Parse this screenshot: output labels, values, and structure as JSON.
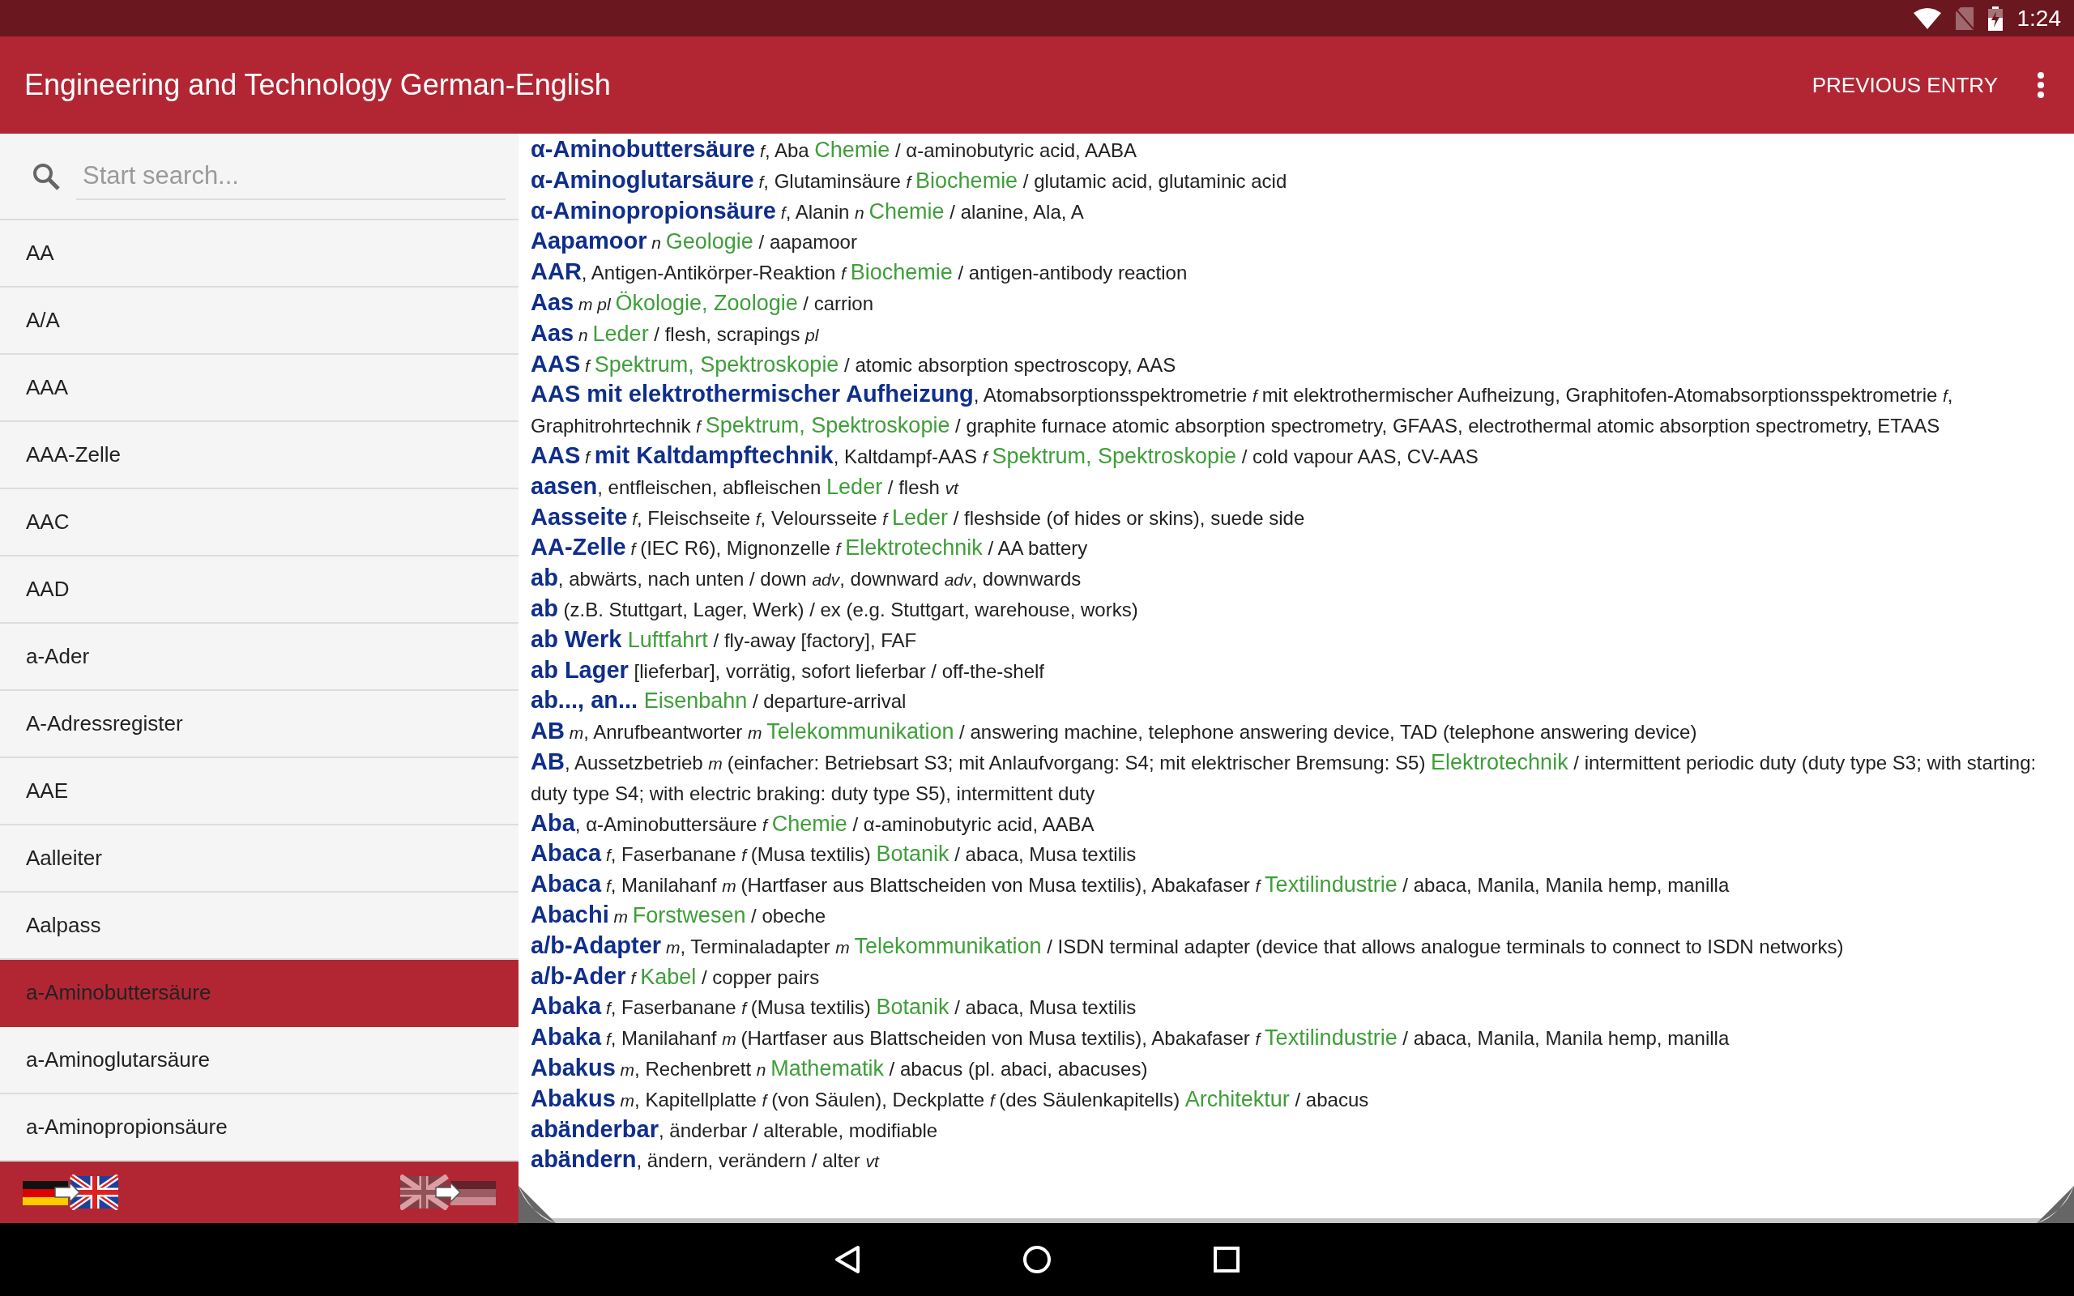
{
  "status_bar": {
    "time": "1:24"
  },
  "app_bar": {
    "title": "Engineering and Technology German-English",
    "actions": [
      "PREVIOUS ENTRY"
    ]
  },
  "search": {
    "placeholder": "Start search..."
  },
  "sidebar": {
    "items": [
      {
        "label": "AA",
        "selected": false
      },
      {
        "label": "A/A",
        "selected": false
      },
      {
        "label": "AAA",
        "selected": false
      },
      {
        "label": "AAA-Zelle",
        "selected": false
      },
      {
        "label": "AAC",
        "selected": false
      },
      {
        "label": "AAD",
        "selected": false
      },
      {
        "label": "a-Ader",
        "selected": false
      },
      {
        "label": "A-Adressregister",
        "selected": false
      },
      {
        "label": "AAE",
        "selected": false
      },
      {
        "label": "Aalleiter",
        "selected": false
      },
      {
        "label": "Aalpass",
        "selected": false
      },
      {
        "label": "a-Aminobuttersäure",
        "selected": true
      },
      {
        "label": "a-Aminoglutarsäure",
        "selected": false
      },
      {
        "label": "a-Aminopropionsäure",
        "selected": false
      }
    ]
  },
  "entries": [
    [
      {
        "kind": "head",
        "text": "α-Aminobuttersäure"
      },
      {
        "kind": "gram",
        "text": " f"
      },
      {
        "kind": "text",
        "text": ", Aba "
      },
      {
        "kind": "field",
        "text": "Chemie"
      },
      {
        "kind": "text",
        "text": " / α-aminobutyric acid, AABA"
      }
    ],
    [
      {
        "kind": "head",
        "text": "α-Aminoglutarsäure"
      },
      {
        "kind": "gram",
        "text": " f"
      },
      {
        "kind": "text",
        "text": ", Glutaminsäure "
      },
      {
        "kind": "gram",
        "text": "f "
      },
      {
        "kind": "field",
        "text": "Biochemie"
      },
      {
        "kind": "text",
        "text": " / glutamic acid, glutaminic acid"
      }
    ],
    [
      {
        "kind": "head",
        "text": "α-Aminopropionsäure"
      },
      {
        "kind": "gram",
        "text": " f"
      },
      {
        "kind": "text",
        "text": ", Alanin "
      },
      {
        "kind": "gram",
        "text": "n "
      },
      {
        "kind": "field",
        "text": "Chemie"
      },
      {
        "kind": "text",
        "text": " / alanine, Ala, A"
      }
    ],
    [
      {
        "kind": "head",
        "text": "Aapamoor"
      },
      {
        "kind": "gram",
        "text": " n "
      },
      {
        "kind": "field",
        "text": "Geologie"
      },
      {
        "kind": "text",
        "text": " / aapamoor"
      }
    ],
    [
      {
        "kind": "head",
        "text": "AAR"
      },
      {
        "kind": "text",
        "text": ", Antigen-Antikörper-Reaktion "
      },
      {
        "kind": "gram",
        "text": "f "
      },
      {
        "kind": "field",
        "text": "Biochemie"
      },
      {
        "kind": "text",
        "text": " / antigen-antibody reaction"
      }
    ],
    [
      {
        "kind": "head",
        "text": "Aas"
      },
      {
        "kind": "gram",
        "text": " m pl "
      },
      {
        "kind": "field",
        "text": "Ökologie, Zoologie"
      },
      {
        "kind": "text",
        "text": " / carrion"
      }
    ],
    [
      {
        "kind": "head",
        "text": "Aas"
      },
      {
        "kind": "gram",
        "text": " n "
      },
      {
        "kind": "field",
        "text": "Leder"
      },
      {
        "kind": "text",
        "text": " / flesh, scrapings "
      },
      {
        "kind": "gram",
        "text": "pl"
      }
    ],
    [
      {
        "kind": "head",
        "text": "AAS"
      },
      {
        "kind": "gram",
        "text": " f "
      },
      {
        "kind": "field",
        "text": "Spektrum, Spektroskopie"
      },
      {
        "kind": "text",
        "text": " / atomic absorption spectroscopy, AAS"
      }
    ],
    [
      {
        "kind": "head",
        "text": "AAS mit elektrothermischer Aufheizung"
      },
      {
        "kind": "text",
        "text": ", Atomabsorptionsspektrometrie "
      },
      {
        "kind": "gram",
        "text": "f "
      },
      {
        "kind": "text",
        "text": "mit elektrothermischer Aufheizung, Graphitofen-Atomabsorptionsspektrometrie "
      },
      {
        "kind": "gram",
        "text": "f"
      },
      {
        "kind": "text",
        "text": ", Graphitrohrtechnik "
      },
      {
        "kind": "gram",
        "text": "f "
      },
      {
        "kind": "field",
        "text": "Spektrum, Spektroskopie"
      },
      {
        "kind": "text",
        "text": " / graphite furnace atomic absorption spectrometry, GFAAS, electrothermal atomic absorption spectrometry, ETAAS"
      }
    ],
    [
      {
        "kind": "head",
        "text": "AAS"
      },
      {
        "kind": "gram",
        "text": " f "
      },
      {
        "kind": "head",
        "text": "mit Kaltdampftechnik"
      },
      {
        "kind": "text",
        "text": ", Kaltdampf-AAS "
      },
      {
        "kind": "gram",
        "text": "f "
      },
      {
        "kind": "field",
        "text": "Spektrum, Spektroskopie"
      },
      {
        "kind": "text",
        "text": " / cold vapour AAS, CV-AAS"
      }
    ],
    [
      {
        "kind": "head",
        "text": "aasen"
      },
      {
        "kind": "text",
        "text": ", entfleischen, abfleischen "
      },
      {
        "kind": "field",
        "text": "Leder"
      },
      {
        "kind": "text",
        "text": " / flesh "
      },
      {
        "kind": "gram",
        "text": "vt"
      }
    ],
    [
      {
        "kind": "head",
        "text": "Aasseite"
      },
      {
        "kind": "gram",
        "text": " f"
      },
      {
        "kind": "text",
        "text": ", Fleischseite "
      },
      {
        "kind": "gram",
        "text": "f"
      },
      {
        "kind": "text",
        "text": ", Veloursseite "
      },
      {
        "kind": "gram",
        "text": "f "
      },
      {
        "kind": "field",
        "text": "Leder"
      },
      {
        "kind": "text",
        "text": " / fleshside (of hides or skins), suede side"
      }
    ],
    [
      {
        "kind": "head",
        "text": "AA-Zelle"
      },
      {
        "kind": "gram",
        "text": " f "
      },
      {
        "kind": "text",
        "text": "(IEC R6), Mignonzelle "
      },
      {
        "kind": "gram",
        "text": "f "
      },
      {
        "kind": "field",
        "text": "Elektrotechnik"
      },
      {
        "kind": "text",
        "text": " / AA battery"
      }
    ],
    [
      {
        "kind": "head",
        "text": "ab"
      },
      {
        "kind": "text",
        "text": ", abwärts, nach unten / down "
      },
      {
        "kind": "gram",
        "text": "adv"
      },
      {
        "kind": "text",
        "text": ", downward "
      },
      {
        "kind": "gram",
        "text": "adv"
      },
      {
        "kind": "text",
        "text": ", downwards"
      }
    ],
    [
      {
        "kind": "head",
        "text": "ab"
      },
      {
        "kind": "text",
        "text": " (z.B. Stuttgart, Lager, Werk) / ex (e.g. Stuttgart, warehouse, works)"
      }
    ],
    [
      {
        "kind": "head",
        "text": "ab Werk"
      },
      {
        "kind": "field",
        "text": " Luftfahrt"
      },
      {
        "kind": "text",
        "text": " / fly-away [factory], FAF"
      }
    ],
    [
      {
        "kind": "head",
        "text": "ab Lager"
      },
      {
        "kind": "text",
        "text": " [lieferbar], vorrätig, sofort lieferbar / off-the-shelf"
      }
    ],
    [
      {
        "kind": "head",
        "text": "ab..., an..."
      },
      {
        "kind": "field",
        "text": " Eisenbahn"
      },
      {
        "kind": "text",
        "text": " / departure-arrival"
      }
    ],
    [
      {
        "kind": "head",
        "text": "AB"
      },
      {
        "kind": "gram",
        "text": " m"
      },
      {
        "kind": "text",
        "text": ", Anrufbeantworter "
      },
      {
        "kind": "gram",
        "text": "m "
      },
      {
        "kind": "field",
        "text": "Telekommunikation"
      },
      {
        "kind": "text",
        "text": " / answering machine, telephone answering device, TAD (telephone answering device)"
      }
    ],
    [
      {
        "kind": "head",
        "text": "AB"
      },
      {
        "kind": "text",
        "text": ", Aussetzbetrieb "
      },
      {
        "kind": "gram",
        "text": "m "
      },
      {
        "kind": "text",
        "text": "(einfacher: Betriebsart S3; mit Anlaufvorgang: S4; mit elektrischer Bremsung: S5) "
      },
      {
        "kind": "field",
        "text": "Elektrotechnik"
      },
      {
        "kind": "text",
        "text": " / intermittent periodic duty (duty type S3; with starting: duty type S4; with electric braking: duty type S5), intermittent duty"
      }
    ],
    [
      {
        "kind": "head",
        "text": "Aba"
      },
      {
        "kind": "text",
        "text": ", α-Aminobuttersäure "
      },
      {
        "kind": "gram",
        "text": "f "
      },
      {
        "kind": "field",
        "text": "Chemie"
      },
      {
        "kind": "text",
        "text": " / α-aminobutyric acid, AABA"
      }
    ],
    [
      {
        "kind": "head",
        "text": "Abaca"
      },
      {
        "kind": "gram",
        "text": " f"
      },
      {
        "kind": "text",
        "text": ", Faserbanane "
      },
      {
        "kind": "gram",
        "text": "f "
      },
      {
        "kind": "text",
        "text": "(Musa textilis) "
      },
      {
        "kind": "field",
        "text": "Botanik"
      },
      {
        "kind": "text",
        "text": " / abaca, Musa textilis"
      }
    ],
    [
      {
        "kind": "head",
        "text": "Abaca"
      },
      {
        "kind": "gram",
        "text": " f"
      },
      {
        "kind": "text",
        "text": ", Manilahanf "
      },
      {
        "kind": "gram",
        "text": "m "
      },
      {
        "kind": "text",
        "text": "(Hartfaser aus Blattscheiden von Musa textilis), Abakafaser "
      },
      {
        "kind": "gram",
        "text": "f "
      },
      {
        "kind": "field",
        "text": "Textilindustrie"
      },
      {
        "kind": "text",
        "text": " / abaca, Manila, Manila hemp, manilla"
      }
    ],
    [
      {
        "kind": "head",
        "text": "Abachi"
      },
      {
        "kind": "gram",
        "text": " m "
      },
      {
        "kind": "field",
        "text": "Forstwesen"
      },
      {
        "kind": "text",
        "text": " / obeche"
      }
    ],
    [
      {
        "kind": "head",
        "text": "a/b-Adapter"
      },
      {
        "kind": "gram",
        "text": " m"
      },
      {
        "kind": "text",
        "text": ", Terminaladapter "
      },
      {
        "kind": "gram",
        "text": "m "
      },
      {
        "kind": "field",
        "text": "Telekommunikation"
      },
      {
        "kind": "text",
        "text": " / ISDN terminal adapter (device that allows analogue terminals to connect to ISDN networks)"
      }
    ],
    [
      {
        "kind": "head",
        "text": "a/b-Ader"
      },
      {
        "kind": "gram",
        "text": " f "
      },
      {
        "kind": "field",
        "text": "Kabel"
      },
      {
        "kind": "text",
        "text": " / copper pairs"
      }
    ],
    [
      {
        "kind": "head",
        "text": "Abaka"
      },
      {
        "kind": "gram",
        "text": " f"
      },
      {
        "kind": "text",
        "text": ", Faserbanane "
      },
      {
        "kind": "gram",
        "text": "f "
      },
      {
        "kind": "text",
        "text": "(Musa textilis) "
      },
      {
        "kind": "field",
        "text": "Botanik"
      },
      {
        "kind": "text",
        "text": " / abaca, Musa textilis"
      }
    ],
    [
      {
        "kind": "head",
        "text": "Abaka"
      },
      {
        "kind": "gram",
        "text": " f"
      },
      {
        "kind": "text",
        "text": ", Manilahanf "
      },
      {
        "kind": "gram",
        "text": "m "
      },
      {
        "kind": "text",
        "text": "(Hartfaser aus Blattscheiden von Musa textilis), Abakafaser "
      },
      {
        "kind": "gram",
        "text": "f "
      },
      {
        "kind": "field",
        "text": "Textilindustrie"
      },
      {
        "kind": "text",
        "text": " / abaca, Manila, Manila hemp, manilla"
      }
    ],
    [
      {
        "kind": "head",
        "text": "Abakus"
      },
      {
        "kind": "gram",
        "text": " m"
      },
      {
        "kind": "text",
        "text": ", Rechenbrett "
      },
      {
        "kind": "gram",
        "text": "n "
      },
      {
        "kind": "field",
        "text": "Mathematik"
      },
      {
        "kind": "text",
        "text": " / abacus (pl. abaci, abacuses)"
      }
    ],
    [
      {
        "kind": "head",
        "text": "Abakus"
      },
      {
        "kind": "gram",
        "text": " m"
      },
      {
        "kind": "text",
        "text": ", Kapitellplatte "
      },
      {
        "kind": "gram",
        "text": "f "
      },
      {
        "kind": "text",
        "text": "(von Säulen), Deckplatte "
      },
      {
        "kind": "gram",
        "text": "f "
      },
      {
        "kind": "text",
        "text": "(des Säulenkapitells) "
      },
      {
        "kind": "field",
        "text": "Architektur"
      },
      {
        "kind": "text",
        "text": " / abacus"
      }
    ],
    [
      {
        "kind": "head",
        "text": "abänderbar"
      },
      {
        "kind": "text",
        "text": ", änderbar / alterable, modifiable"
      }
    ],
    [
      {
        "kind": "head",
        "text": "abändern"
      },
      {
        "kind": "text",
        "text": ", ändern, verändern / alter "
      },
      {
        "kind": "gram",
        "text": "vt"
      }
    ]
  ]
}
